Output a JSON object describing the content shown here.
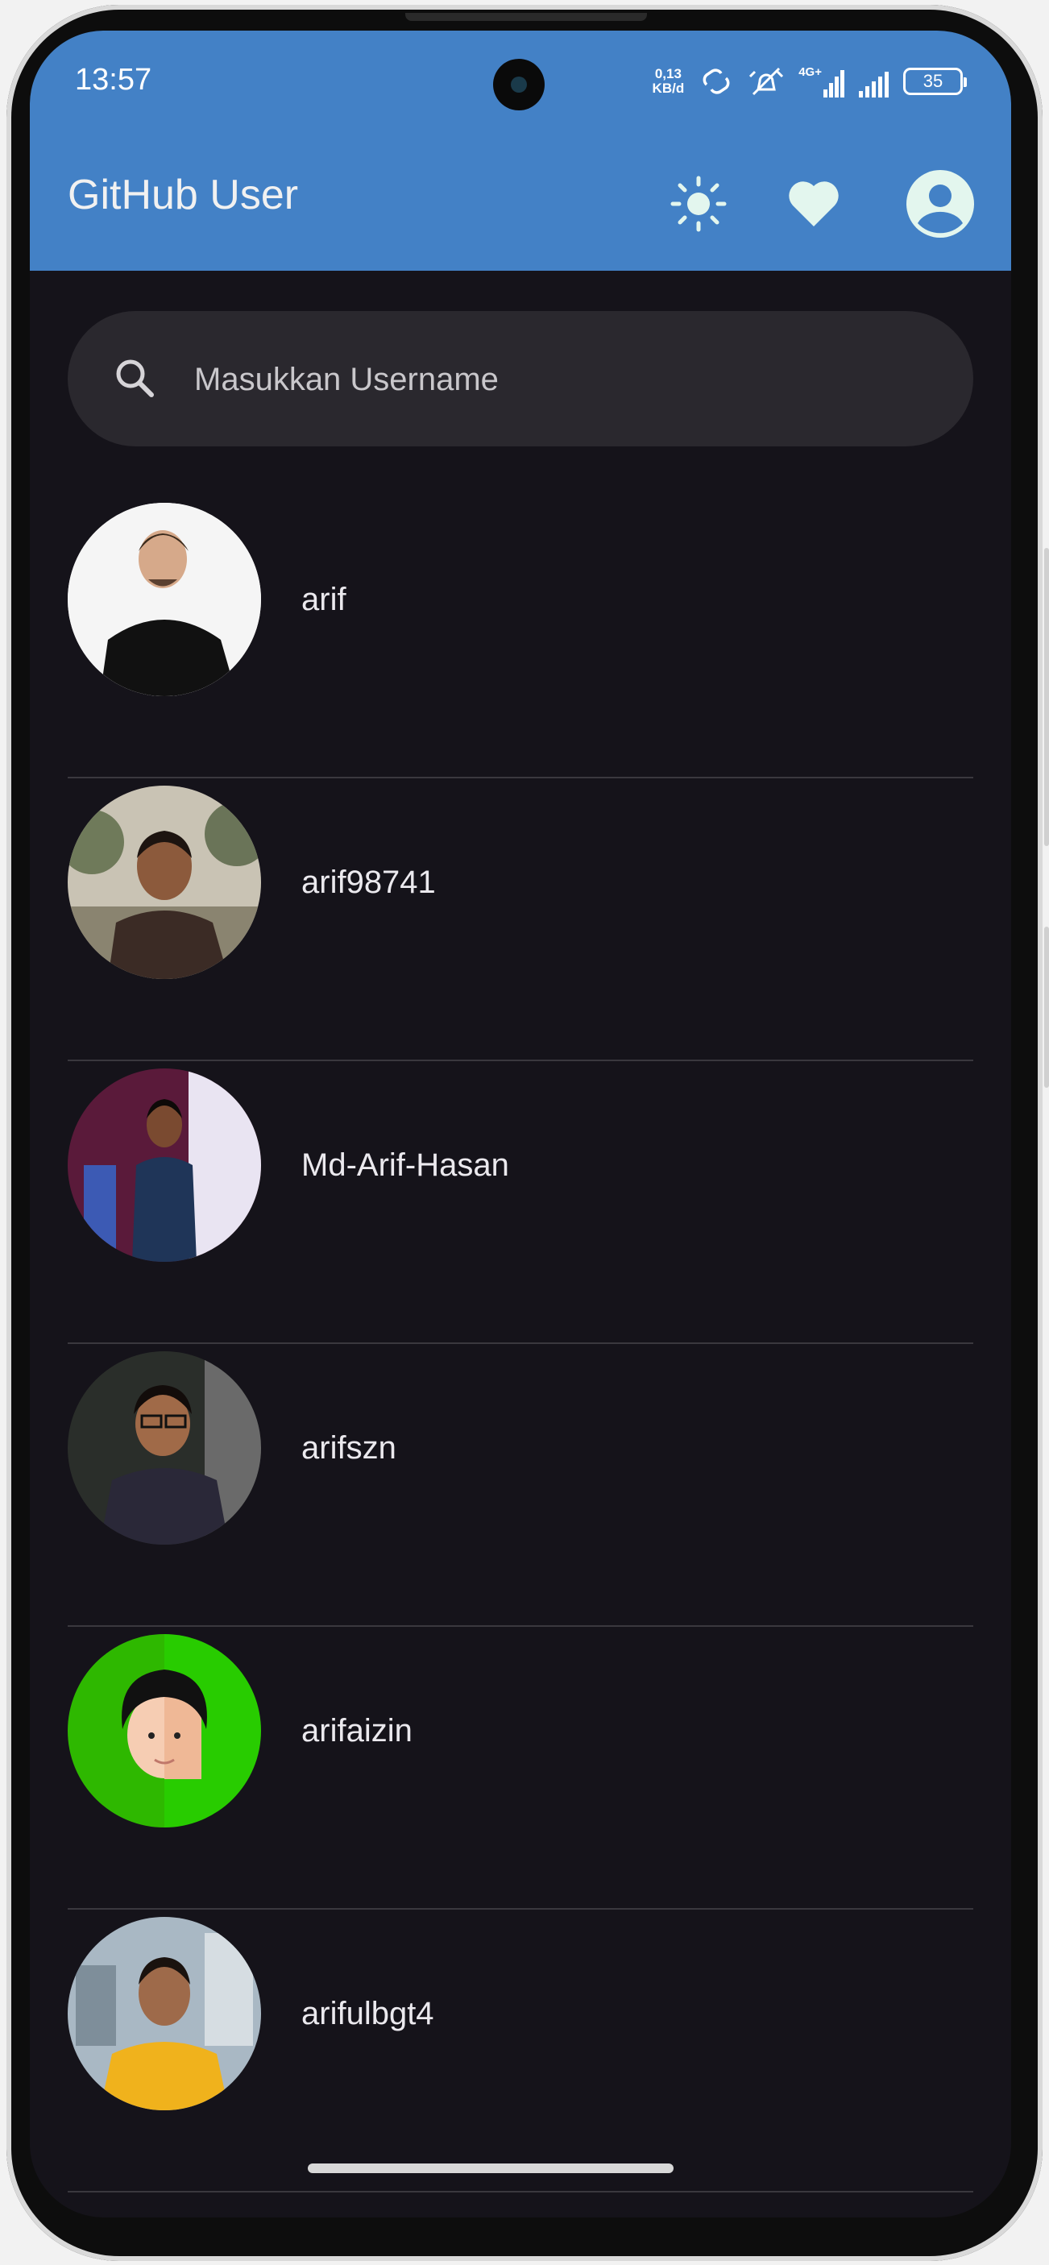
{
  "status_bar": {
    "time": "13:57",
    "net_speed_value": "0,13",
    "net_speed_unit": "KB/d",
    "network_type": "4G+",
    "battery": "35"
  },
  "app_bar": {
    "title": "GitHub User",
    "background": "#4381c6"
  },
  "search": {
    "placeholder": "Masukkan Username"
  },
  "users": [
    {
      "username": "arif"
    },
    {
      "username": "arif98741"
    },
    {
      "username": "Md-Arif-Hasan"
    },
    {
      "username": "arifszn"
    },
    {
      "username": "arifaizin"
    },
    {
      "username": "arifulbgt4"
    }
  ],
  "colors": {
    "background": "#15131a",
    "accent": "#4381c6",
    "icon_tint": "#e3f6ee"
  }
}
